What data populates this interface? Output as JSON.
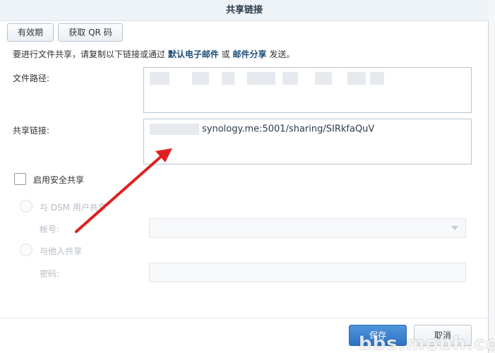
{
  "dialog": {
    "title": "共享链接"
  },
  "toolbar": {
    "validity_label": "有效期",
    "qr_label": "获取 QR 码"
  },
  "hint": {
    "prefix": "要进行文件共享，请复制以下链接或通过 ",
    "email_link": "默认电子邮件",
    "or": " 或 ",
    "mail_share_link": "邮件分享",
    "suffix": " 发送。"
  },
  "fields": {
    "path_label": "文件路径:",
    "link_label": "共享链接:",
    "link_value": "synology.me:5001/sharing/SIRkfaQuV"
  },
  "security": {
    "enable_label": "启用安全共享",
    "dsm_users_label": "与 DSM 用户共享",
    "account_label": "帐号:",
    "others_label": "与他人共享",
    "password_label": "密码:"
  },
  "footer": {
    "save_label": "保存",
    "cancel_label": "取消"
  },
  "watermark": {
    "text": "bbs.mobh.com"
  },
  "colors": {
    "accent": "#2f73c3",
    "annotation_arrow": "#e02020"
  }
}
